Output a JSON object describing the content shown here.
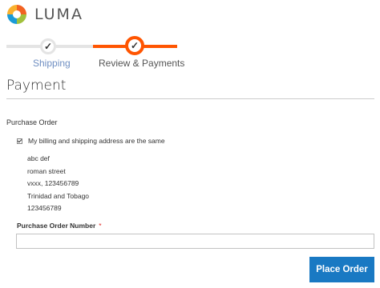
{
  "logo": {
    "text": "LUMA",
    "icon": "luma-logo-icon"
  },
  "progress": {
    "steps": [
      {
        "label": "Shipping",
        "state": "complete",
        "icon": "checkmark-icon"
      },
      {
        "label": "Review & Payments",
        "state": "active",
        "icon": "checkmark-icon"
      }
    ],
    "colors": {
      "active": "#ff5501",
      "inactive": "#e4e4e4",
      "complete_label": "#6f8fc2"
    }
  },
  "payment": {
    "title": "Payment",
    "method_title": "Purchase Order",
    "same_address_label": "My billing and shipping address are the same",
    "same_address_checked": true,
    "address_lines": [
      "abc def",
      "roman street",
      "vxxx, 123456789",
      "Trinidad and Tobago",
      "123456789"
    ],
    "po_number_label": "Purchase Order Number",
    "po_required_mark": "*",
    "po_number_value": "",
    "place_order_label": "Place Order"
  },
  "colors": {
    "primary_button": "#1979c3",
    "required": "#e02b27"
  }
}
